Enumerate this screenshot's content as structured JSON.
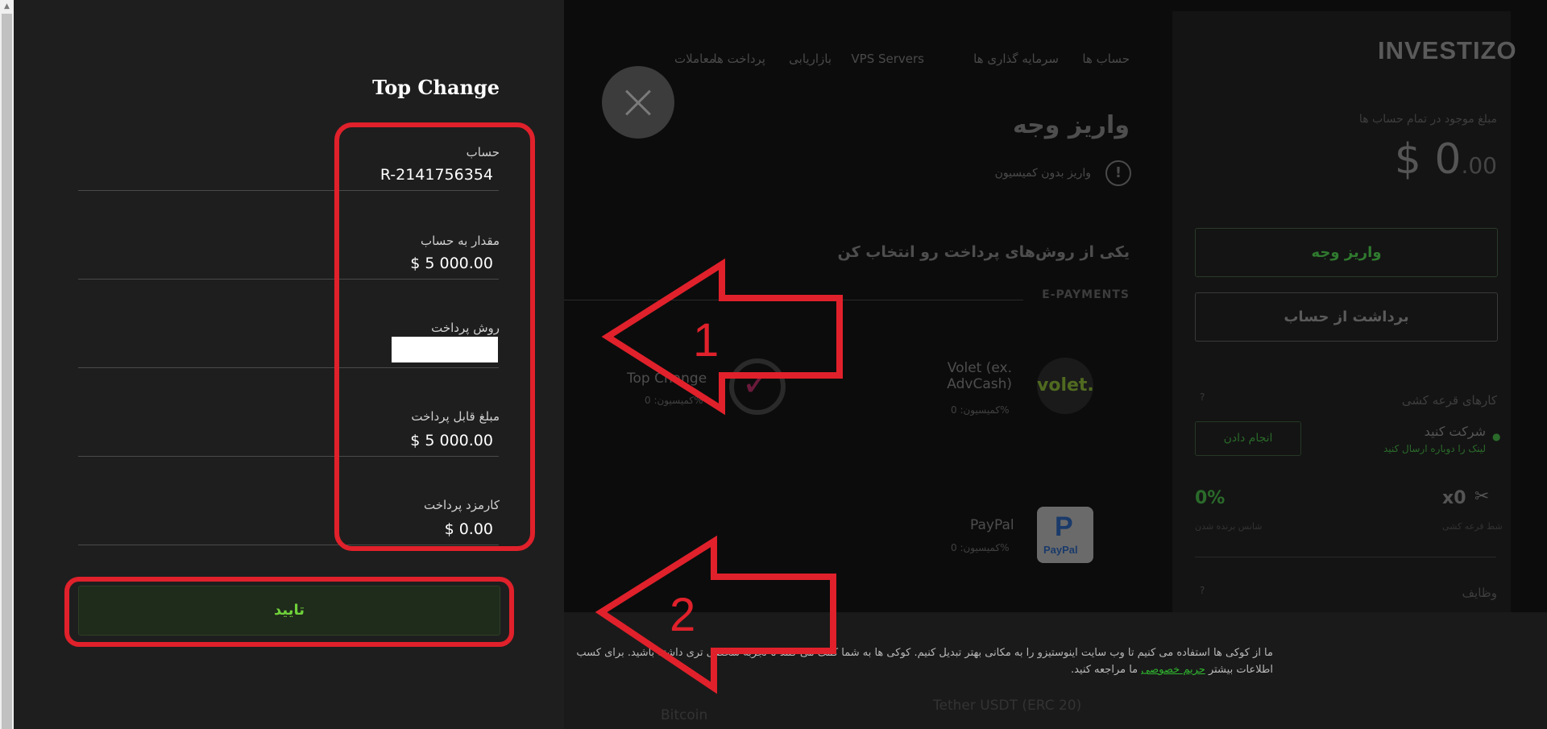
{
  "nav": {
    "items": [
      "حساب ها",
      "سرمایه گذاری ها",
      "VPS Servers",
      "بازاریابی",
      "پرداخت ها",
      "معاملات"
    ]
  },
  "brand": {
    "logo": "INVESTIZO"
  },
  "page": {
    "title": "واریز وجه",
    "no_commission": "واریز بدون کمیسیون",
    "choose_method": "یکی از روش‌های پرداخت رو انتخاب کن",
    "section": "E-PAYMENTS",
    "methods": [
      {
        "name": "Volet (ex. AdvCash)",
        "commission": "کمیسیون: 0%",
        "logo_text": "volet."
      },
      {
        "name": "Top Change",
        "commission": "کمیسیون: 0%"
      },
      {
        "name": "PayPal",
        "commission": "کمیسیون: 0%"
      },
      {
        "name": "Tether USDT (ERC 20)",
        "commission": ""
      },
      {
        "name": "Bitcoin",
        "commission": ""
      }
    ]
  },
  "sidebar": {
    "balance_label": "مبلغ موجود در تمام حساب ها",
    "balance_main": "$ 0",
    "balance_cents": ".00",
    "deposit_button": "واریز وجه",
    "withdraw_button": "برداشت از حساب",
    "lottery_title": "کارهای قرعه کشی",
    "lottery_help": "?",
    "task_title": "شرکت کنید",
    "task_sub": "لینک را دوباره ارسال کنید",
    "task_button": "انجام دادن",
    "stat_left_value": "0%",
    "stat_left_label": "شانس برنده شدن",
    "stat_right_value": "x0",
    "stat_right_label": "شط قرعه کشی",
    "tasks_title": "وظایف",
    "tasks_help": "?"
  },
  "cookie": {
    "text": "ما از کوکی ها استفاده می کنیم تا وب سایت اینوستیزو را به مکانی بهتر تبدیل کنیم. کوکی ها به شما کمک می کنند تا تجربه شخصی تری داشته باشید. برای کسب اطلاعات بیشتر",
    "link": "حریم خصوصی",
    "text_end": "ما مراجعه کنید."
  },
  "modal": {
    "title": "Top Change",
    "fields": [
      {
        "label": "حساب",
        "value": "R-2141756354"
      },
      {
        "label": "مقدار به حساب",
        "value": "$ 5 000.00"
      },
      {
        "label": "روش پرداخت",
        "value": ""
      },
      {
        "label": "مبلغ قابل پرداخت",
        "value": "$ 5 000.00"
      },
      {
        "label": "کارمزد پرداخت",
        "value": "$ 0.00"
      }
    ],
    "confirm_button": "تایید"
  },
  "annotations": {
    "arrow1": "1",
    "arrow2": "2",
    "color": "#e0212b"
  },
  "colors": {
    "accent_green": "#6fd13a",
    "modal_bg": "#1e1e1e",
    "page_bg": "#0c0c0c"
  }
}
